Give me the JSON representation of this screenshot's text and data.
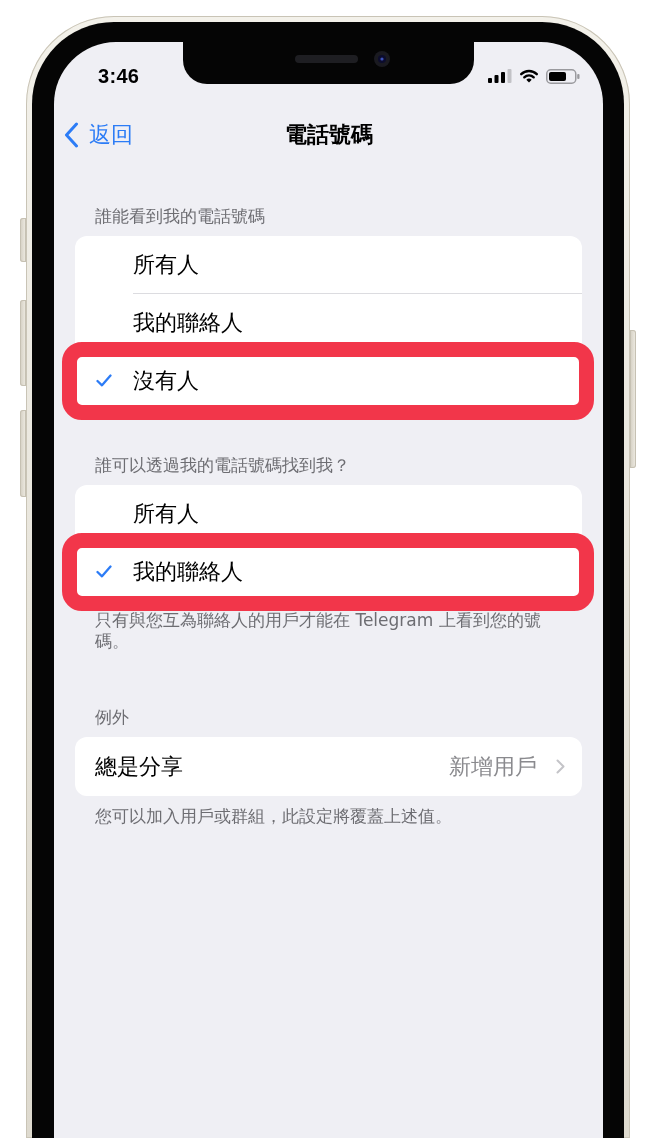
{
  "status_bar": {
    "time": "3:46"
  },
  "nav_bar": {
    "back": "返回",
    "title": "電話號碼"
  },
  "sections": [
    {
      "header": "誰能看到我的電話號碼",
      "rows": [
        {
          "kind": "option",
          "label": "所有人",
          "selected": false,
          "highlighted": false
        },
        {
          "kind": "option",
          "label": "我的聯絡人",
          "selected": false,
          "highlighted": false
        },
        {
          "kind": "option",
          "label": "沒有人",
          "selected": true,
          "highlighted": true
        }
      ]
    },
    {
      "header": "誰可以透過我的電話號碼找到我？",
      "rows": [
        {
          "kind": "option",
          "label": "所有人",
          "selected": false,
          "highlighted": false
        },
        {
          "kind": "option",
          "label": "我的聯絡人",
          "selected": true,
          "highlighted": true
        }
      ],
      "footer": "只有與您互為聯絡人的用戶才能在 Telegram 上看到您的號碼。"
    },
    {
      "header": "例外",
      "rows": [
        {
          "kind": "link",
          "label": "總是分享",
          "value": "新增用戶"
        }
      ],
      "footer": "您可以加入用戶或群組，此設定將覆蓋上述值。"
    }
  ]
}
